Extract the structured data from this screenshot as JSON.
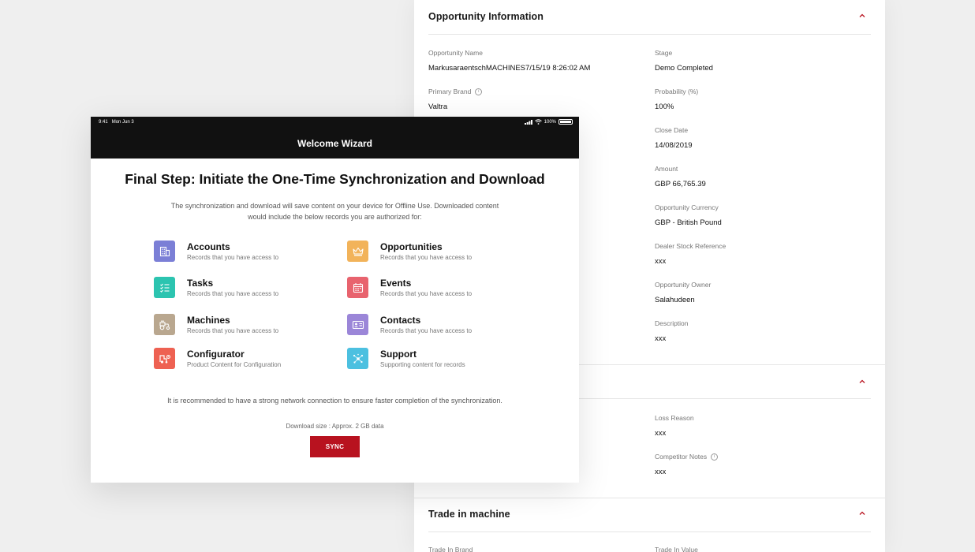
{
  "record": {
    "sections": [
      {
        "title": "Opportunity Information"
      },
      {
        "title": ""
      },
      {
        "title": "Trade in machine"
      }
    ],
    "fields_left": [
      {
        "label": "Opportunity Name",
        "value": "MarkusaraentschMACHINES7/15/19 8:26:02 AM"
      },
      {
        "label": "Primary Brand",
        "value": "Valtra"
      }
    ],
    "fields_right": [
      {
        "label": "Stage",
        "value": "Demo Completed"
      },
      {
        "label": "Probability (%)",
        "value": "100%"
      },
      {
        "label": "Close Date",
        "value": "14/08/2019"
      },
      {
        "label": "Amount",
        "value": "GBP 66,765.39"
      },
      {
        "label": "Opportunity Currency",
        "value": "GBP - British Pound"
      },
      {
        "label": "Dealer Stock Reference",
        "value": "xxx"
      },
      {
        "label": "Opportunity  Owner",
        "value": "Salahudeen"
      },
      {
        "label": "Description",
        "value": "xxx"
      }
    ],
    "section2_fields": [
      {
        "label": "Loss Reason",
        "value": "xxx"
      },
      {
        "label": "Competitor Notes",
        "value": "xxx"
      }
    ],
    "section3_fields": [
      {
        "label": "Trade In Brand"
      },
      {
        "label": "Trade In Value"
      }
    ],
    "info_glyph": "i"
  },
  "wizard": {
    "status": {
      "time": "9:41",
      "date": "Mon Jun 3",
      "battery": "100%"
    },
    "title": "Welcome Wizard",
    "step_title": "Final Step: Initiate the One-Time Synchronization and Download",
    "description": "The synchronization and download will save content on your device for Offline Use. Downloaded content would include the below records you are authorized for:",
    "items": [
      {
        "title": "Accounts",
        "subtitle": "Records that you have access to",
        "icon": "building-icon",
        "color": "#7b7fd6"
      },
      {
        "title": "Opportunities",
        "subtitle": "Records that you have access to",
        "icon": "crown-icon",
        "color": "#f2b35a"
      },
      {
        "title": "Tasks",
        "subtitle": "Records that you have access to",
        "icon": "checklist-icon",
        "color": "#2cc4b0"
      },
      {
        "title": "Events",
        "subtitle": "Records that you have access to",
        "icon": "calendar-icon",
        "color": "#e8636e"
      },
      {
        "title": "Machines",
        "subtitle": "Records that you have access to",
        "icon": "tractor-icon",
        "color": "#b9a78f"
      },
      {
        "title": "Contacts",
        "subtitle": "Records that you have access to",
        "icon": "contact-card-icon",
        "color": "#9b86d8"
      },
      {
        "title": "Configurator",
        "subtitle": "Product Content for Configuration",
        "icon": "configurator-icon",
        "color": "#ee6152"
      },
      {
        "title": "Support",
        "subtitle": "Supporting content for records",
        "icon": "network-icon",
        "color": "#4cc0e0"
      }
    ],
    "note": "It is recommended to have a strong network connection to ensure faster completion of the synchronization.",
    "download_size": "Download size : Approx. 2 GB data",
    "sync_label": "SYNC",
    "accent": "#b8121f"
  }
}
